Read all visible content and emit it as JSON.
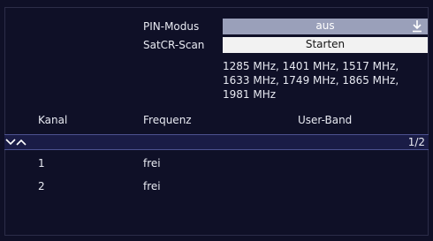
{
  "settings": {
    "pin_label": "PIN-Modus",
    "pin_value": "aus",
    "satcr_label": "SatCR-Scan",
    "satcr_button": "Starten",
    "frequencies": "1285 MHz, 1401 MHz, 1517 MHz, 1633 MHz, 1749 MHz, 1865 MHz, 1981 MHz"
  },
  "table": {
    "headers": [
      "Kanal",
      "Frequenz",
      "User-Band"
    ],
    "page_indicator": "1/2",
    "rows": [
      {
        "kanal": "1",
        "frequenz": "frei",
        "user_band": ""
      },
      {
        "kanal": "2",
        "frequenz": "frei",
        "user_band": ""
      }
    ]
  },
  "icons": {
    "dropdown": "download-arrow-icon",
    "scroll": "chevron-down-up-icon"
  },
  "colors": {
    "background": "#0f1027",
    "dropdown_bg": "#9aa0ba",
    "button_bg": "#f2f2f2",
    "highlight_bar": "#1a1c46"
  }
}
